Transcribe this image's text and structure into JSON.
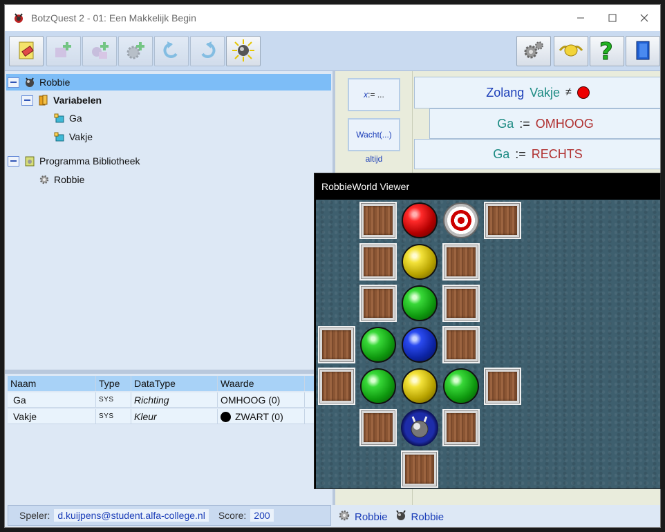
{
  "window": {
    "title": "BotzQuest 2 - 01: Een Makkelijk Begin"
  },
  "tree": {
    "root_label": "Robbie",
    "variables_label": "Variabelen",
    "variables": [
      "Ga",
      "Vakje"
    ],
    "library_label": "Programma Bibliotheek",
    "library_items": [
      "Robbie"
    ]
  },
  "var_table": {
    "headers": [
      "Naam",
      "Type",
      "DataType",
      "Waarde"
    ],
    "rows": [
      {
        "naam": "Ga",
        "type": "SYS",
        "datatype": "Richting",
        "waarde": "OMHOOG (0)"
      },
      {
        "naam": "Vakje",
        "type": "SYS",
        "datatype": "Kleur",
        "waarde": "ZWART (0)"
      }
    ]
  },
  "status": {
    "player_label": "Speler:",
    "player_value": "d.kuijpens@student.alfa-college.nl",
    "score_label": "Score:",
    "score_value": "200",
    "right_item1": "Robbie",
    "right_item2": "Robbie"
  },
  "palette": {
    "assign_label_x": "x",
    "assign_label_rest": " := ...",
    "wait_label": "Wacht(...)",
    "always_label": "altijd"
  },
  "code": {
    "while_kw": "Zolang",
    "while_var": "Vakje",
    "while_op": "≠",
    "assign1_var": "Ga",
    "assign1_op": ":=",
    "assign1_val": "OMHOOG",
    "assign2_var": "Ga",
    "assign2_op": ":=",
    "assign2_val": "RECHTS"
  },
  "viewer": {
    "title": "RobbieWorld Viewer"
  },
  "colors": {
    "accent_blue": "#1a3db8",
    "selection": "#7dbdf7",
    "board": "#3e5f6e"
  },
  "board": {
    "grid": [
      [
        "",
        "wall",
        "red",
        "target",
        "wall",
        "",
        "",
        ""
      ],
      [
        "",
        "wall",
        "yellow",
        "wall",
        "",
        "",
        "",
        ""
      ],
      [
        "",
        "wall",
        "green",
        "wall",
        "",
        "",
        "",
        ""
      ],
      [
        "wall",
        "green",
        "blue",
        "wall",
        "",
        "",
        "",
        ""
      ],
      [
        "wall",
        "green",
        "yellow",
        "green",
        "wall",
        "",
        "",
        ""
      ],
      [
        "",
        "wall",
        "robot",
        "wall",
        "",
        "",
        "",
        ""
      ],
      [
        "",
        "",
        "wall",
        "",
        "",
        "",
        "",
        ""
      ]
    ]
  }
}
